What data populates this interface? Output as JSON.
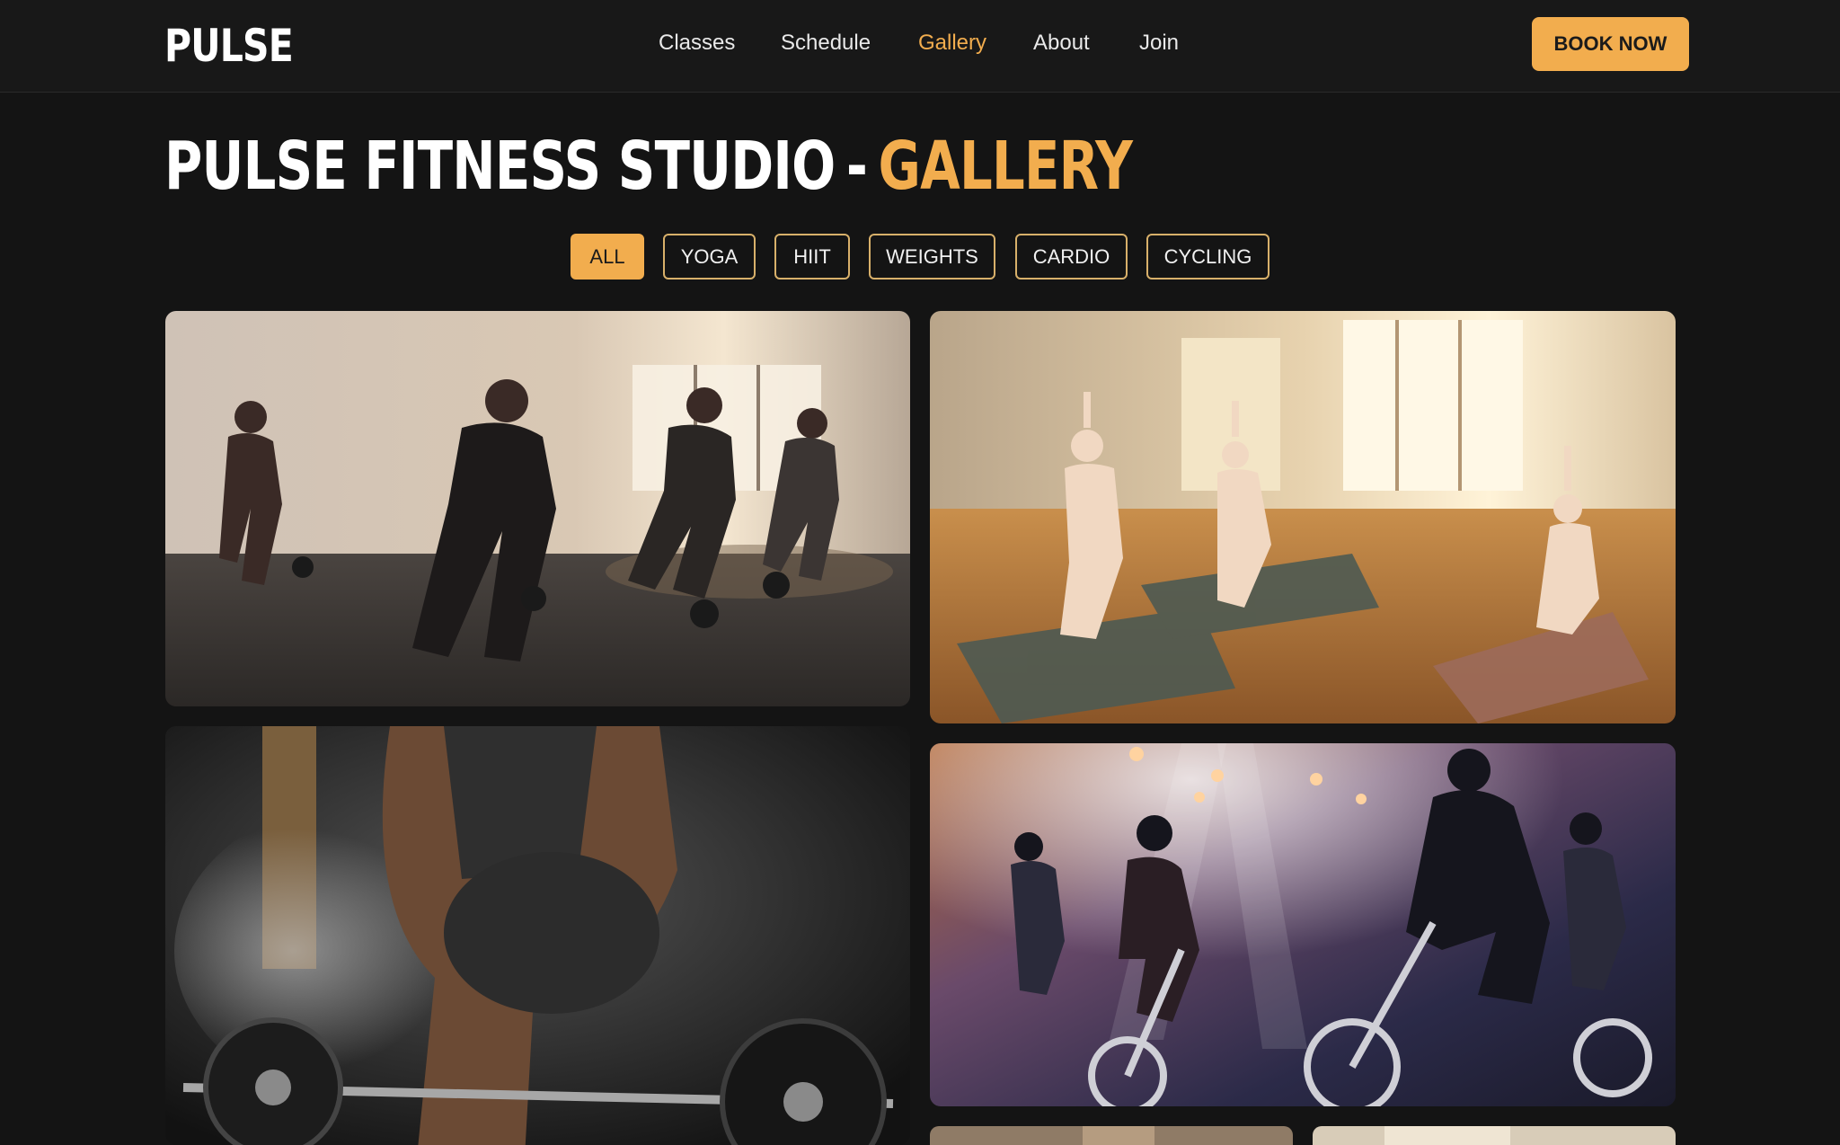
{
  "brand": {
    "logo": "PULSE"
  },
  "nav": {
    "items": [
      {
        "label": "Classes"
      },
      {
        "label": "Schedule"
      },
      {
        "label": "Gallery",
        "active": true
      },
      {
        "label": "About"
      },
      {
        "label": "Join"
      }
    ],
    "cta_label": "BOOK NOW"
  },
  "page": {
    "title_main": "PULSE FITNESS STUDIO",
    "title_separator": "-",
    "title_accent": "GALLERY"
  },
  "filters": [
    {
      "label": "ALL",
      "active": true
    },
    {
      "label": "YOGA"
    },
    {
      "label": "HIIT"
    },
    {
      "label": "WEIGHTS"
    },
    {
      "label": "CARDIO"
    },
    {
      "label": "CYCLING"
    }
  ],
  "gallery": {
    "photos": [
      {
        "subject": "hiit-class-photo"
      },
      {
        "subject": "yoga-class-photo"
      },
      {
        "subject": "weights-deadlift-photo"
      },
      {
        "subject": "cycling-class-photo"
      },
      {
        "subject": "photo"
      },
      {
        "subject": "photo"
      }
    ]
  },
  "colors": {
    "accent": "#f2ad4e",
    "background": "#141414",
    "header": "#181818"
  }
}
